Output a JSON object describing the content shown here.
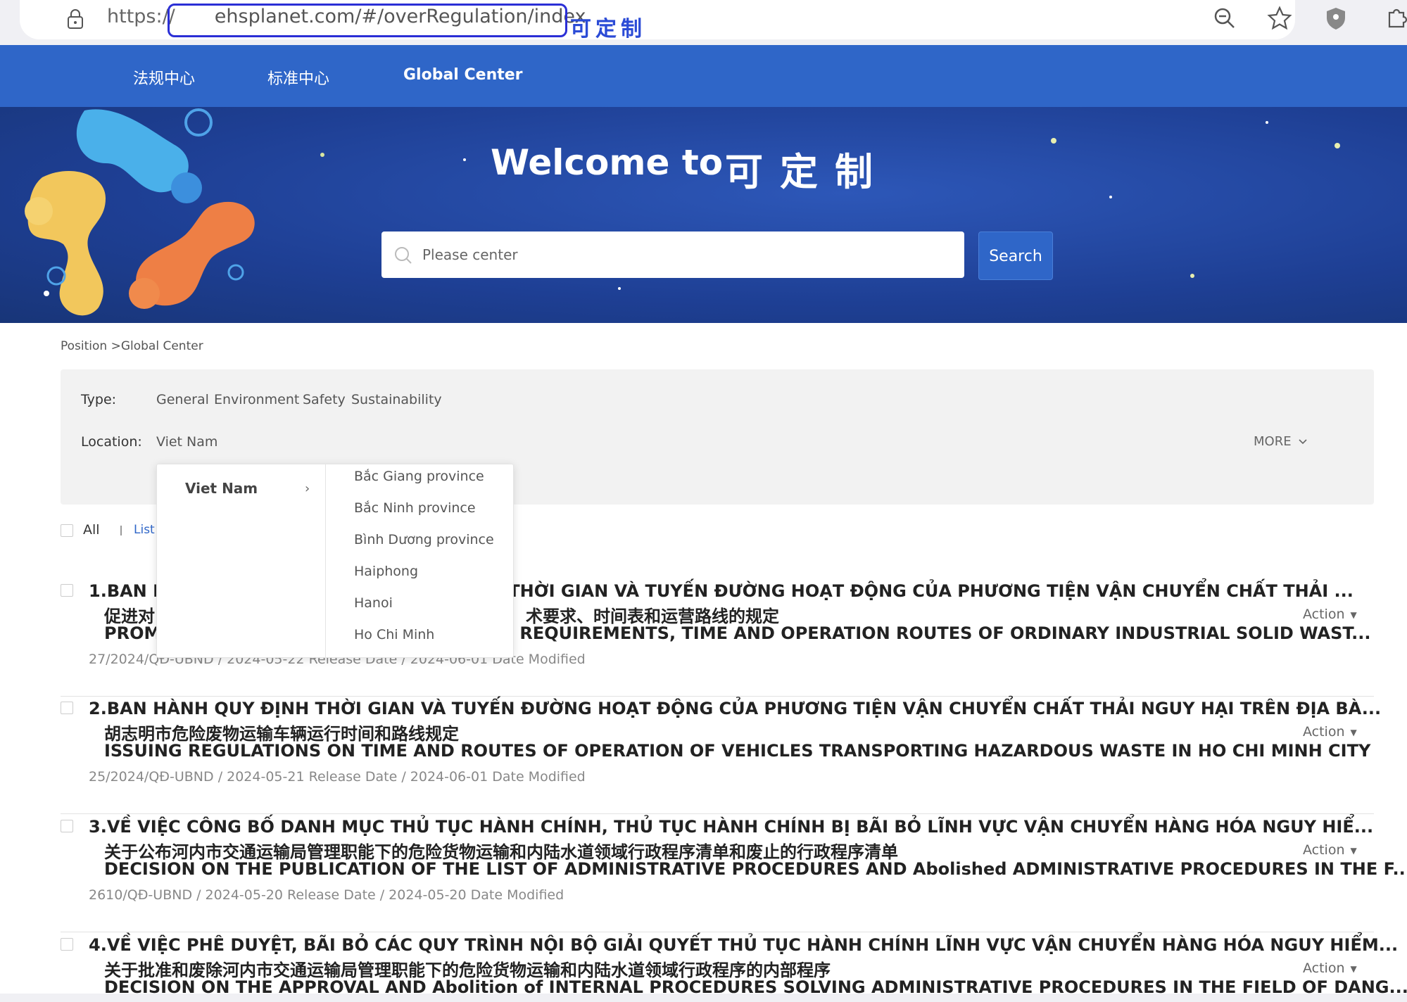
{
  "browser": {
    "url_prefix": "https://",
    "url_domain": "ehsplanet.com/#/overRegulation/index",
    "annotation": "可定制"
  },
  "nav": {
    "items": [
      "法规中心",
      "标准中心",
      "Global Center"
    ]
  },
  "hero": {
    "welcome": "Welcome to",
    "brand": "可定制",
    "search_placeholder": "Please center",
    "search_button": "Search"
  },
  "breadcrumb": "Position >Global Center",
  "filters": {
    "type_label": "Type:",
    "types": [
      "General",
      "Environment",
      "Safety",
      "Sustainability"
    ],
    "location_label": "Location:",
    "location_value": "Viet Nam",
    "more_label": "MORE"
  },
  "list_controls": {
    "all_label": "All",
    "list_label": "List"
  },
  "cascade": {
    "country": "Viet Nam",
    "provinces": [
      "Bắc Giang province",
      "Bắc Ninh province",
      "Bình Dương province",
      "Haiphong",
      "Hanoi",
      "Ho Chi Minh"
    ]
  },
  "records": [
    {
      "title": "1.BAN H",
      "title_tail": "THỜI GIAN VÀ TUYẾN ĐƯỜNG HOẠT ĐỘNG CỦA PHƯƠNG TIỆN VẬN CHUYỂN CHẤT THẢI ...",
      "cn": "促进对",
      "cn_tail": "术要求、时间表和运营路线的规定",
      "en": "PROM",
      "en_tail": "REQUIREMENTS, TIME AND OPERATION ROUTES OF ORDINARY INDUSTRIAL SOLID WAST...",
      "meta": "27/2024/QĐ-UBND / 2024-05-22 Release Date / 2024-06-01 Date Modified",
      "action": "Action"
    },
    {
      "title": "2.BAN HÀNH QUY ĐỊNH THỜI GIAN VÀ TUYẾN ĐƯỜNG HOẠT ĐỘNG CỦA PHƯƠNG TIỆN VẬN CHUYỂN CHẤT THẢI NGUY HẠI TRÊN ĐỊA BÀ...",
      "cn": "胡志明市危险废物运输车辆运行时间和路线规定",
      "en": "ISSUING REGULATIONS ON TIME AND ROUTES OF OPERATION OF VEHICLES TRANSPORTING HAZARDOUS WASTE IN HO CHI MINH CITY",
      "meta": "25/2024/QĐ-UBND / 2024-05-21 Release Date / 2024-06-01 Date Modified",
      "action": "Action"
    },
    {
      "title": "3.VỀ VIỆC CÔNG BỐ DANH MỤC THỦ TỤC HÀNH CHÍNH, THỦ TỤC HÀNH CHÍNH BỊ BÃI BỎ LĨNH VỰC VẬN CHUYỂN HÀNG HÓA NGUY HIỂ...",
      "cn": "关于公布河内市交通运输局管理职能下的危险货物运输和内陆水道领域行政程序清单和废止的行政程序清单",
      "en": "DECISION ON THE PUBLICATION OF THE LIST OF ADMINISTRATIVE PROCEDURES AND Abolished ADMINISTRATIVE PROCEDURES IN THE F...",
      "meta": "2610/QĐ-UBND / 2024-05-20 Release Date / 2024-05-20 Date Modified",
      "action": "Action"
    },
    {
      "title": "4.VỀ VIỆC PHÊ DUYỆT, BÃI BỎ CÁC QUY TRÌNH NỘI BỘ GIẢI QUYẾT THỦ TỤC HÀNH CHÍNH LĨNH VỰC VẬN CHUYỂN HÀNG HÓA NGUY HIỂM...",
      "cn": "关于批准和废除河内市交通运输局管理职能下的危险货物运输和内陆水道领域行政程序的内部程序",
      "en": "DECISION ON THE APPROVAL AND Abolition of INTERNAL PROCEDURES SOLVING ADMINISTRATIVE PROCEDURES IN THE FIELD OF DANG...",
      "action": "Action"
    }
  ],
  "colors": {
    "nav_blue": "#2f66c8",
    "hero_blue": "#1e3f94",
    "annotation_blue": "#2b2fd6"
  }
}
